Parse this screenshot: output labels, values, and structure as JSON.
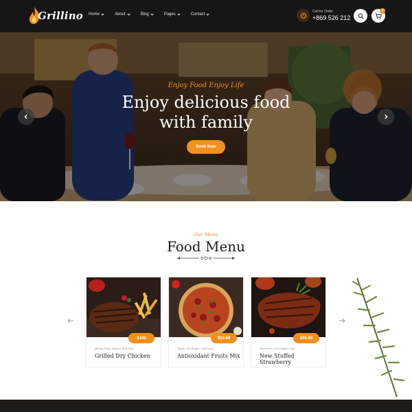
{
  "header": {
    "logo_text": "Grillino",
    "nav": [
      {
        "label": "Home"
      },
      {
        "label": "About"
      },
      {
        "label": "Blog"
      },
      {
        "label": "Pages"
      },
      {
        "label": "Contact"
      }
    ],
    "call_label": "Call for Order",
    "call_number": "+869 526 212",
    "cart_count": "0",
    "icons": [
      "flame-logo-icon",
      "phone-icon",
      "search-icon",
      "cart-icon"
    ]
  },
  "hero": {
    "subtitle": "Enjoy Food Enjoy Life",
    "title_line1": "Enjoy delicious food",
    "title_line2": "with family",
    "button_label": "Book Now"
  },
  "menu": {
    "subtitle": "Our Menu",
    "title": "Food Menu",
    "items": [
      {
        "ingredients": "Mining Potao, Binjani, Soft Drink",
        "name": "Grilled Dry Chicken",
        "price": "$100"
      },
      {
        "ingredients": "Sauce, Hot Burger, Soft Drink",
        "name": "Antioxidant Fruits Mix",
        "price": "$19.99"
      },
      {
        "ingredients": "Other Item, Lau Chingri, Fish",
        "name": "New Stuffed Strawberry",
        "price": "$99.99"
      }
    ]
  },
  "colors": {
    "accent": "#f3901b",
    "header_bg": "#161616",
    "text_dark": "#1b1b1b"
  }
}
